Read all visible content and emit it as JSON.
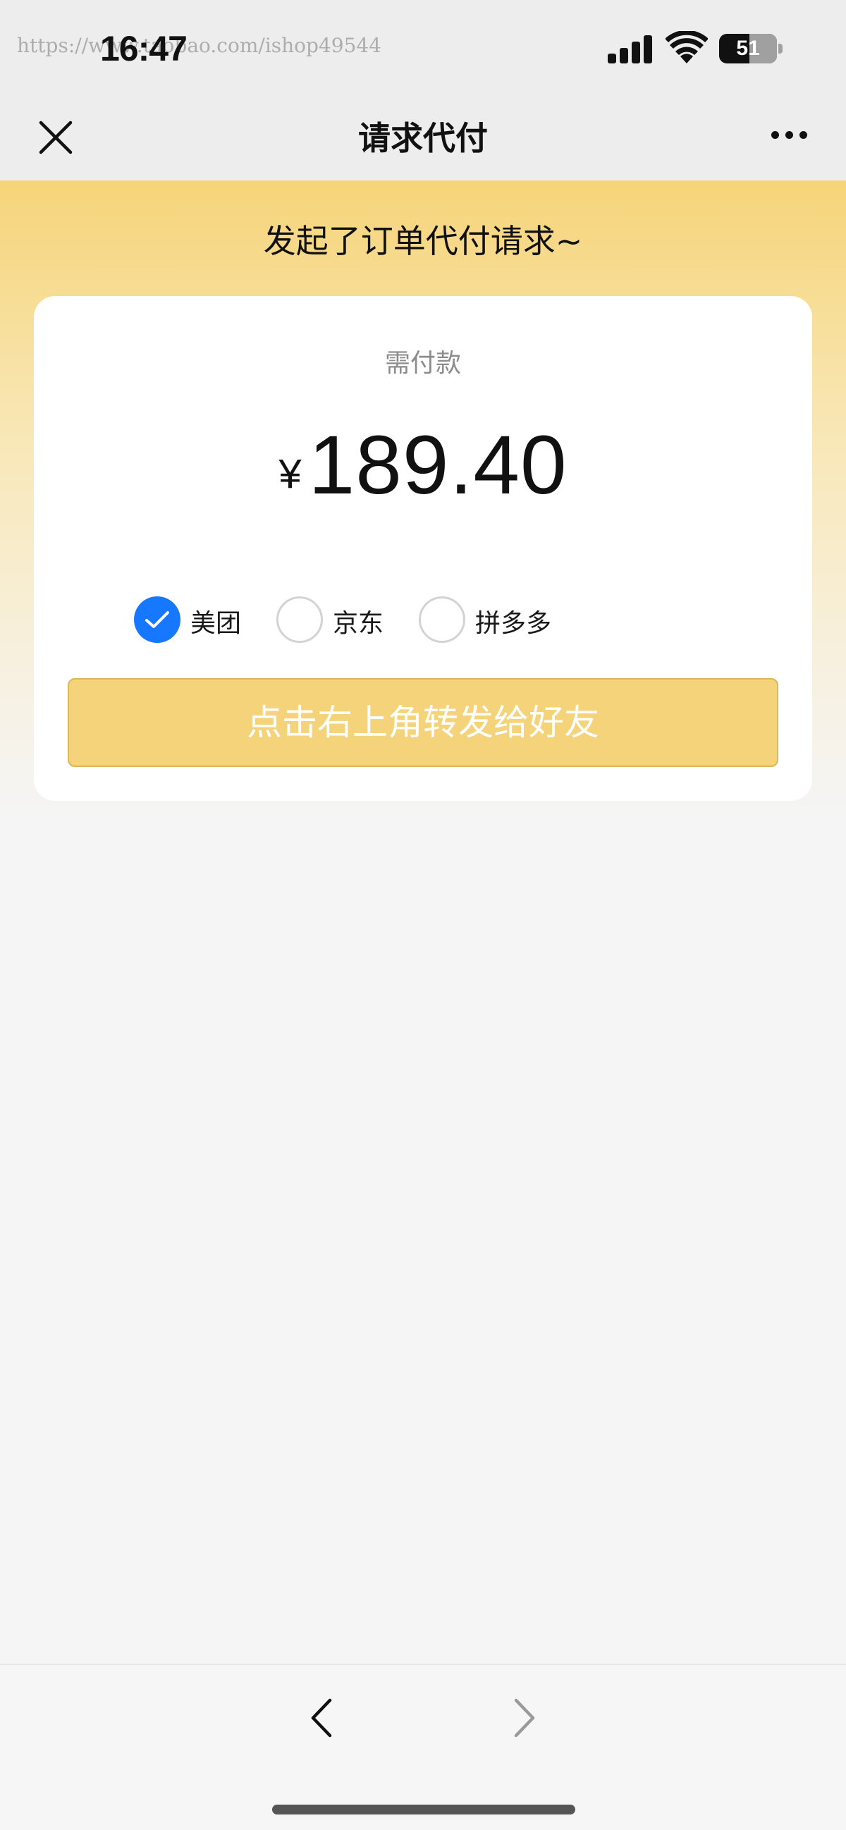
{
  "status_bar": {
    "time": "16:47",
    "watermark": "https://www.taobao.com/ishop49544",
    "battery": "51",
    "battery_level": 0.51,
    "icons": [
      "signal-icon",
      "wifi-icon",
      "battery-icon"
    ]
  },
  "nav": {
    "title": "请求代付",
    "close_icon": "close-icon",
    "more_icon": "more-icon"
  },
  "banner": {
    "text": "发起了订单代付请求~"
  },
  "card": {
    "pay_label": "需付款",
    "currency": "¥",
    "amount": "189.40",
    "platforms": [
      {
        "label": "美团",
        "checked": true
      },
      {
        "label": "京东",
        "checked": false
      },
      {
        "label": "拼多多",
        "checked": false
      }
    ],
    "share_button": "点击右上角转发给好友"
  },
  "toolbar": {
    "back_icon": "chevron-left-icon",
    "forward_icon": "chevron-right-icon"
  },
  "colors": {
    "accent_blue": "#1677ff",
    "button_yellow": "#f5d37a",
    "banner_yellow": "#f6d479"
  }
}
